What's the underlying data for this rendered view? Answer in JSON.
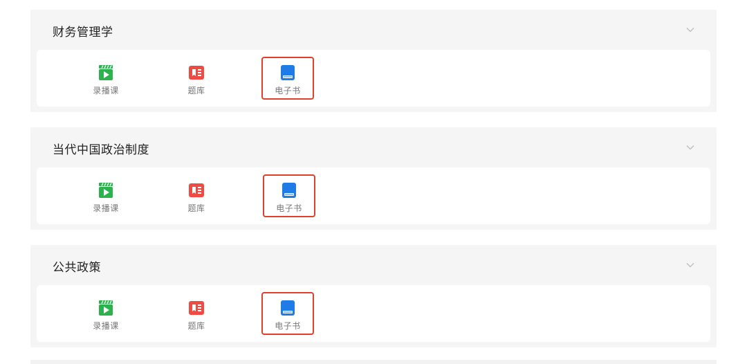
{
  "sections": [
    {
      "title": "财务管理学",
      "items": [
        {
          "label": "录播课",
          "icon": "video-icon",
          "color": "#2bb24c"
        },
        {
          "label": "题库",
          "icon": "question-bank-icon",
          "color": "#f04b42"
        },
        {
          "label": "电子书",
          "icon": "ebook-icon",
          "color": "#1f7ce6"
        }
      ]
    },
    {
      "title": "当代中国政治制度",
      "items": [
        {
          "label": "录播课",
          "icon": "video-icon",
          "color": "#2bb24c"
        },
        {
          "label": "题库",
          "icon": "question-bank-icon",
          "color": "#f04b42"
        },
        {
          "label": "电子书",
          "icon": "ebook-icon",
          "color": "#1f7ce6"
        }
      ]
    },
    {
      "title": "公共政策",
      "items": [
        {
          "label": "录播课",
          "icon": "video-icon",
          "color": "#2bb24c"
        },
        {
          "label": "题库",
          "icon": "question-bank-icon",
          "color": "#f04b42"
        },
        {
          "label": "电子书",
          "icon": "ebook-icon",
          "color": "#1f7ce6"
        }
      ]
    }
  ],
  "highlight_color": "#e0402a"
}
